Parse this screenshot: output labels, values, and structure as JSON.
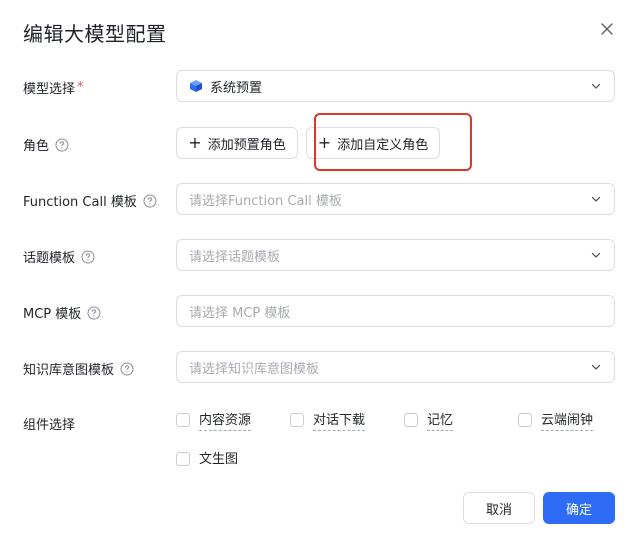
{
  "dialog": {
    "title": "编辑大模型配置",
    "close_icon": "close-icon"
  },
  "model": {
    "label": "模型选择",
    "required_mark": "*",
    "selected": "系统预置",
    "icon": "cube-icon",
    "icon_color": "#2f6cf6"
  },
  "role": {
    "label": "角色",
    "add_preset_label": "添加预置角色",
    "add_custom_label": "添加自定义角色"
  },
  "function_call": {
    "label": "Function Call 模板",
    "placeholder": "请选择Function Call 模板"
  },
  "topic": {
    "label": "话题模板",
    "placeholder": "请选择话题模板"
  },
  "mcp": {
    "label": "MCP 模板",
    "placeholder": "请选择 MCP 模板"
  },
  "knowledge": {
    "label": "知识库意图模板",
    "placeholder": "请选择知识库意图模板"
  },
  "components": {
    "label": "组件选择",
    "options": [
      {
        "label": "内容资源",
        "checked": false
      },
      {
        "label": "对话下载",
        "checked": false
      },
      {
        "label": "记忆",
        "checked": false
      },
      {
        "label": "云端闹钟",
        "checked": false
      },
      {
        "label": "文生图",
        "checked": false
      }
    ]
  },
  "footer": {
    "cancel_label": "取消",
    "confirm_label": "确定"
  },
  "colors": {
    "primary": "#2f6cf6",
    "highlight": "#d8392b",
    "required": "#e34d59"
  }
}
